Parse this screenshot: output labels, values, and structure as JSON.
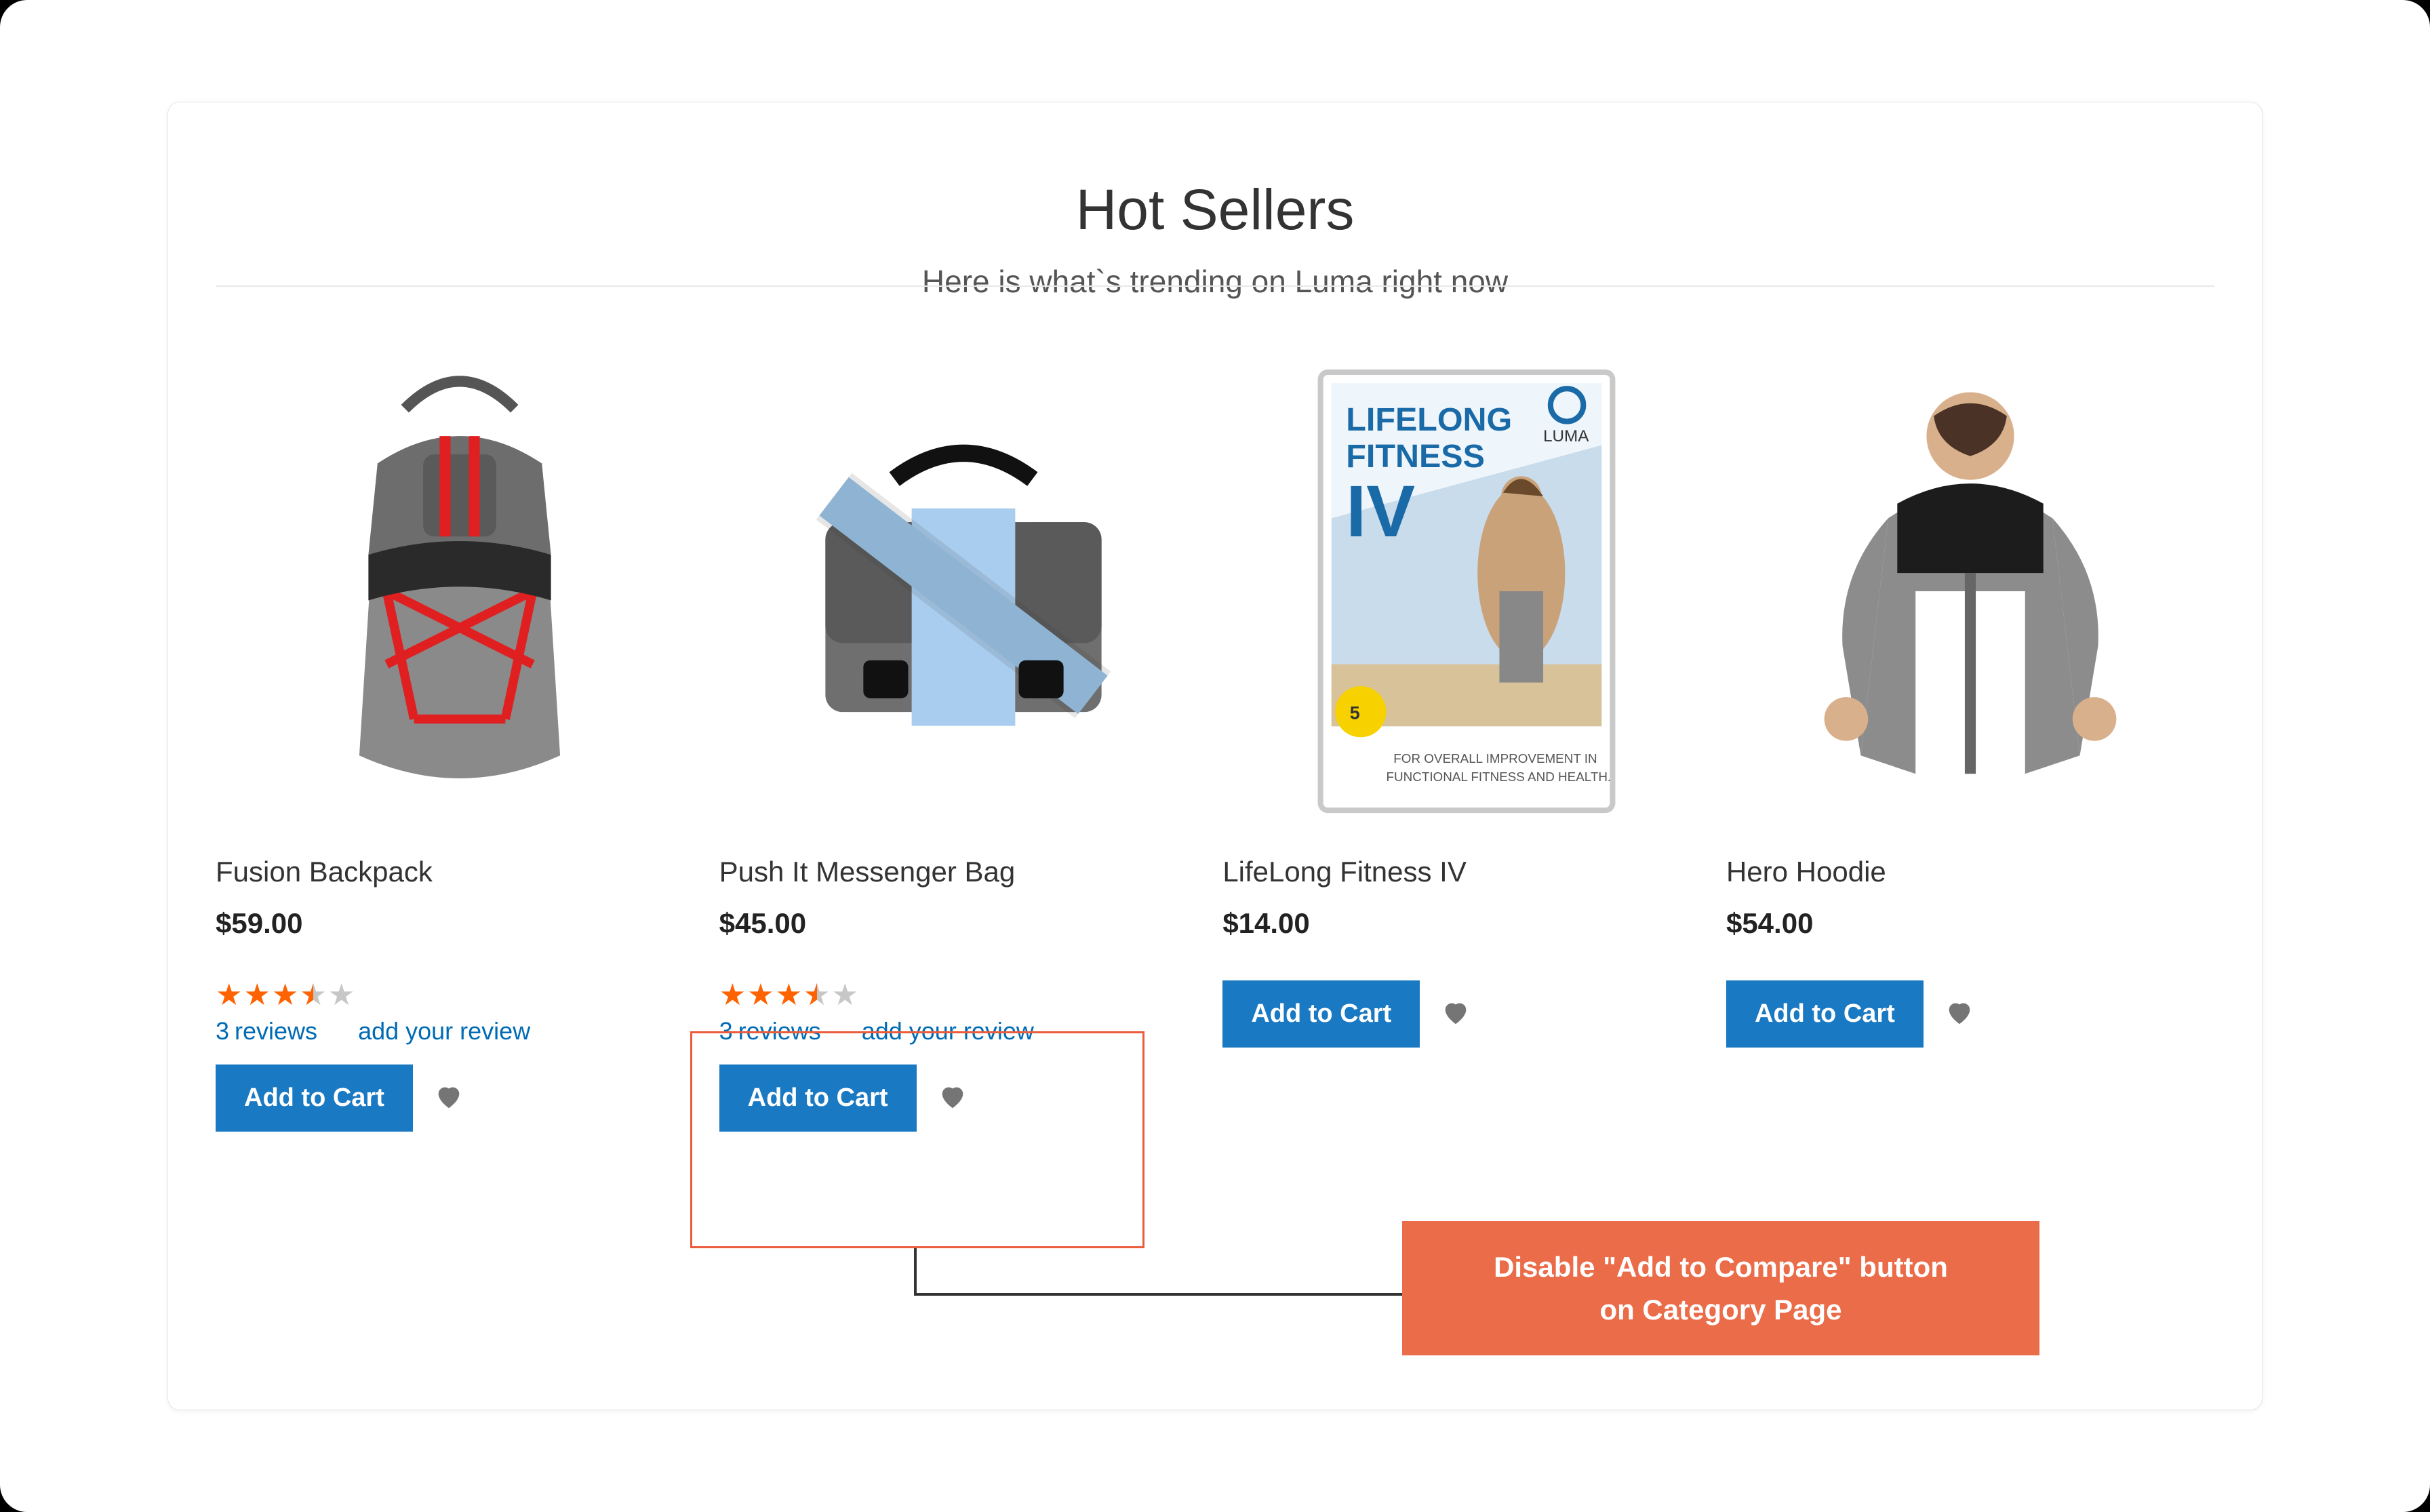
{
  "section": {
    "title": "Hot Sellers",
    "subtitle": "Here is what`s trending on Luma right now"
  },
  "products": [
    {
      "name": "Fusion Backpack",
      "price": "$59.00",
      "rating": 3.5,
      "reviews_count": "3",
      "reviews_label": "reviews",
      "add_review_label": "add your review",
      "cart_label": "Add to Cart",
      "has_reviews": true
    },
    {
      "name": "Push It Messenger Bag",
      "price": "$45.00",
      "rating": 3.5,
      "reviews_count": "3",
      "reviews_label": "reviews",
      "add_review_label": "add your review",
      "cart_label": "Add to Cart",
      "has_reviews": true
    },
    {
      "name": "LifeLong Fitness IV",
      "price": "$14.00",
      "cart_label": "Add to Cart",
      "has_reviews": false
    },
    {
      "name": "Hero Hoodie",
      "price": "$54.00",
      "cart_label": "Add to Cart",
      "has_reviews": false
    }
  ],
  "callout": {
    "line1": "Disable \"Add to Compare\" button",
    "line2": "on Category Page"
  },
  "colors": {
    "accent": "#1979c3",
    "star": "#ff6200",
    "callout": "#eb6c49",
    "highlight": "#eb5b3c",
    "link": "#006bb4"
  }
}
